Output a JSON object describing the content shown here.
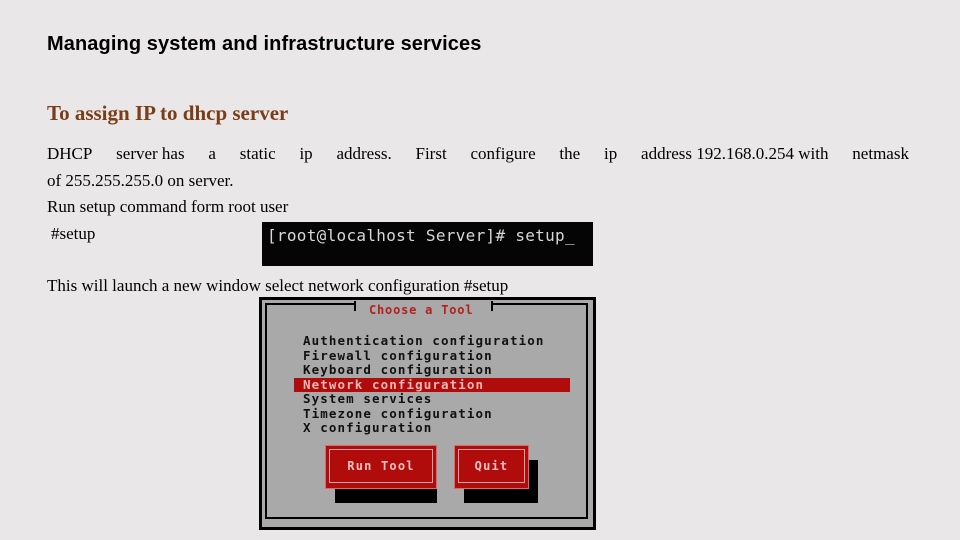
{
  "slide": {
    "title": "Managing system and infrastructure services",
    "subtitle": "To assign IP to dhcp server",
    "paragraph_line1_words": [
      "DHCP",
      "server has",
      "a",
      "static",
      "ip",
      "address.",
      "First",
      "configure",
      "the",
      "ip",
      "address 192.168.0.254 with",
      "netmask"
    ],
    "paragraph_line2": "of 255.255.255.0 on server.",
    "paragraph_line3": "Run setup command form root user",
    "paragraph_line4": "#setup",
    "paragraph_line5": "This will launch a new window select network configuration #setup"
  },
  "terminal": {
    "prompt": "[root@localhost Server]# setup_"
  },
  "setup_dialog": {
    "title": "Choose a Tool",
    "menu_items": [
      {
        "label": "Authentication configuration",
        "selected": false
      },
      {
        "label": "Firewall configuration",
        "selected": false
      },
      {
        "label": "Keyboard configuration",
        "selected": false
      },
      {
        "label": "Network configuration",
        "selected": true
      },
      {
        "label": "System services",
        "selected": false
      },
      {
        "label": "Timezone configuration",
        "selected": false
      },
      {
        "label": "X configuration",
        "selected": false
      }
    ],
    "buttons": {
      "run_tool": "Run Tool",
      "quit": "Quit"
    },
    "colors": {
      "highlight": "#b00c0c",
      "background": "#a9a9a9",
      "title": "#b41f1f"
    }
  }
}
